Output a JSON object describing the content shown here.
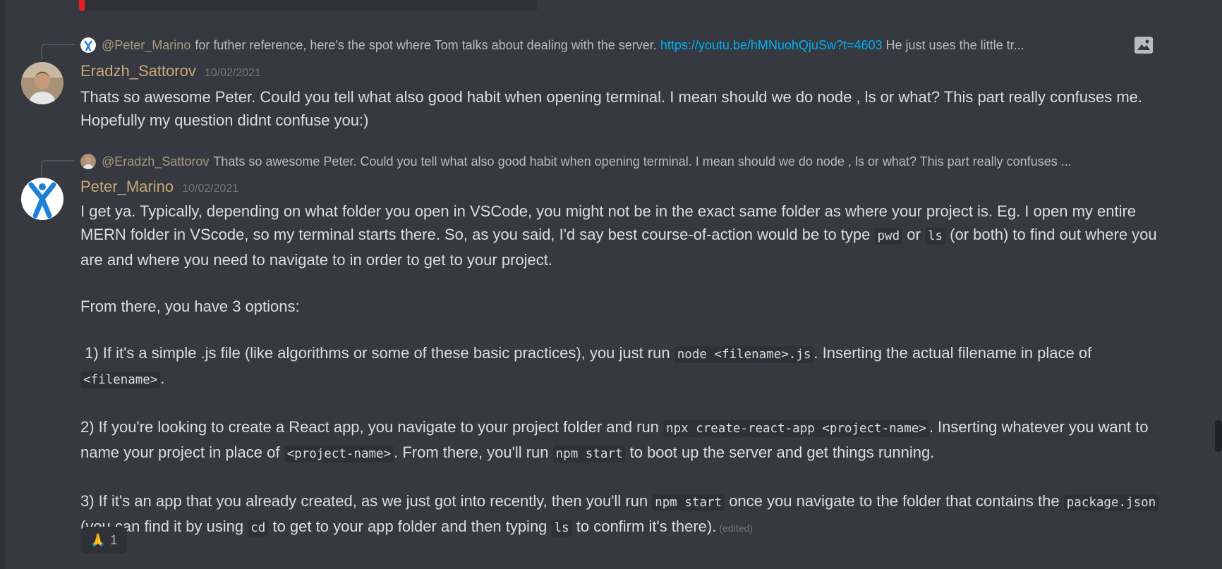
{
  "messages": [
    {
      "reply": {
        "author": "@Peter_Marino",
        "text": "for futher reference, here's the spot where Tom talks about dealing with the server.",
        "link": "https://youtu.be/hMNuohQjuSw?t=4603",
        "tail": "He just uses the little tr..."
      },
      "author": "Eradzh_Sattorov",
      "timestamp": "10/02/2021",
      "lines": [
        "Thats so awesome Peter. Could you tell what also good habit when opening terminal. I mean should we do node , ls or what? This part really confuses me.",
        "Hopefully my question didnt confuse you:)"
      ]
    },
    {
      "reply": {
        "author": "@Eradzh_Sattorov",
        "text": "Thats so awesome Peter. Could you tell what also good habit when opening terminal. I mean should we do node , ls or what? This part really confuses ..."
      },
      "author": "Peter_Marino",
      "timestamp": "10/02/2021",
      "p1": {
        "a": "I get ya. Typically, depending on what folder you open in VSCode, you might not be in the exact same folder as where your project is. Eg. I open my entire MERN folder in VScode, so my terminal starts there. So, as you said, I'd say best course-of-action would be to type",
        "code1": "pwd",
        "b": "or",
        "code2": "ls",
        "c": "(or both) to find out where you are and where you need to navigate to in order to get to your project."
      },
      "p2": "From there, you have 3 options:",
      "p3": {
        "a": " 1) If it's a simple .js file (like algorithms or some of these basic practices), you just run",
        "code1": "node <filename>.js",
        "b": ". Inserting the actual filename in place of",
        "code2": "<filename>",
        "c": "."
      },
      "p4": {
        "a": "2) If you're looking to create a React app, you navigate to your project folder and run",
        "code1": "npx create-react-app <project-name>",
        "b": ". Inserting whatever you want to name your project in place of",
        "code2": "<project-name>",
        "c": ". From there, you'll run",
        "code3": "npm start",
        "d": "to boot up the server and get things running."
      },
      "p5": {
        "a": "3) If it's an app that you already created, as we just got into recently, then you'll run",
        "code1": "npm start",
        "b": "once you navigate to the folder that contains the",
        "code2": "package.json",
        "c": "(you can find it by using",
        "code3": "cd",
        "d": "to get to your app folder and then typing",
        "code4": "ls",
        "e": "to confirm it's there).",
        "edited": "(edited)"
      },
      "reaction": {
        "emoji": "🙏",
        "count": "1"
      }
    }
  ]
}
